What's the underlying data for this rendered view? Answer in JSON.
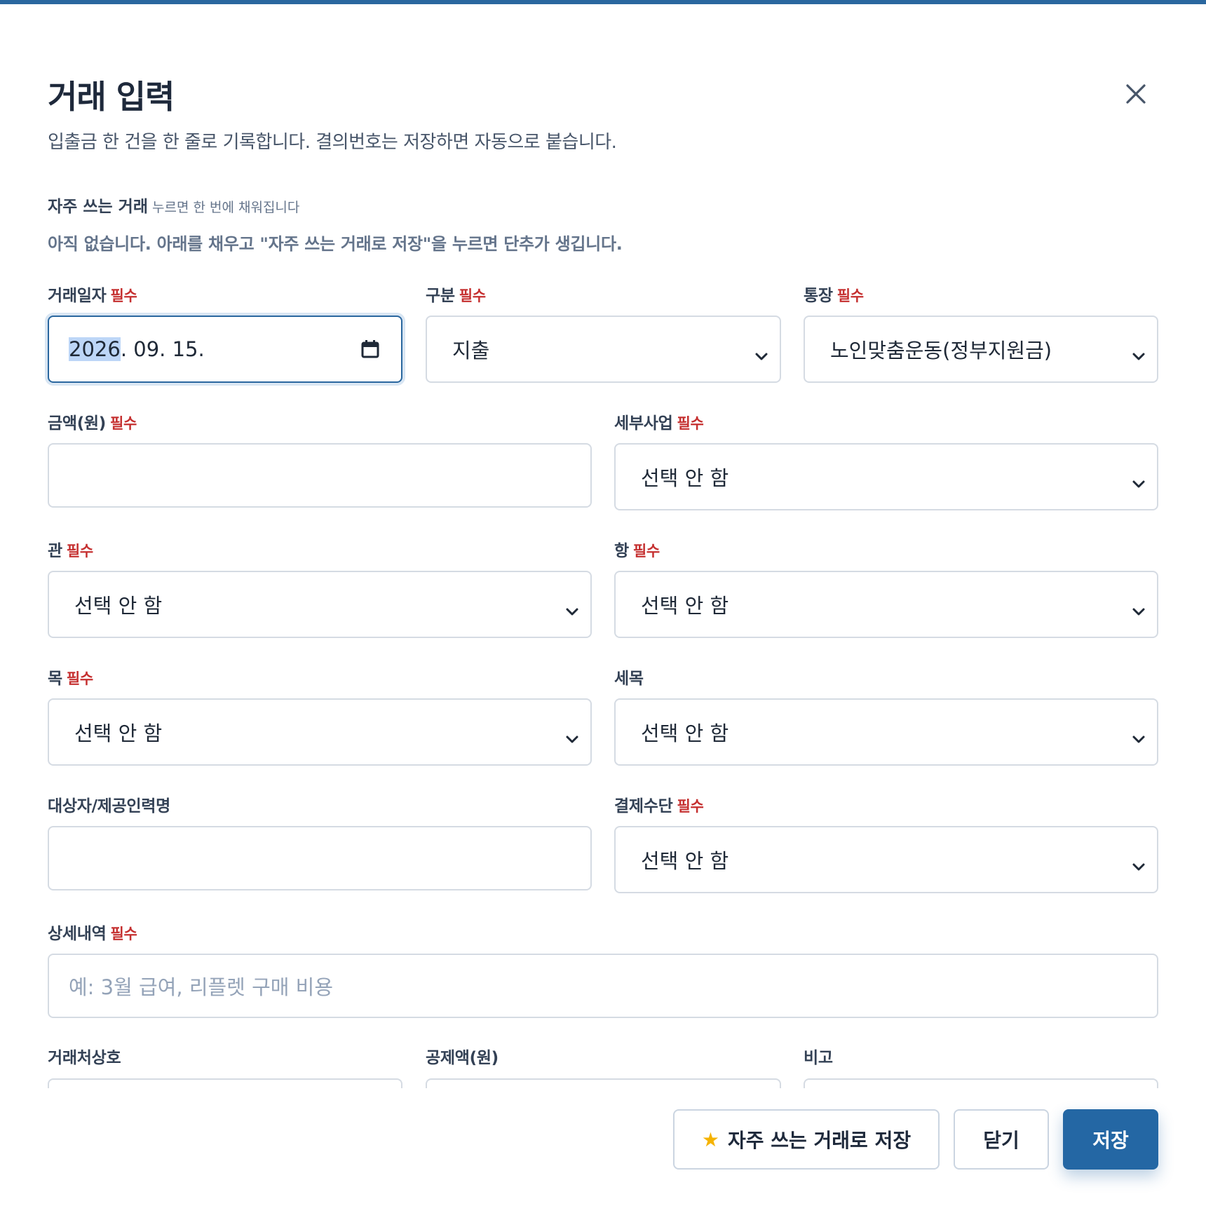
{
  "dialog": {
    "title": "거래 입력",
    "subtitle": "입출금 한 건을 한 줄로 기록합니다. 결의번호는 저장하면 자동으로 붙습니다.",
    "close_icon": "close-icon"
  },
  "favorites": {
    "heading": "자주 쓰는 거래",
    "hint": "누르면 한 번에 채워집니다",
    "empty_text": "아직 없습니다. 아래를 채우고 \"자주 쓰는 거래로 저장\"을 누르면 단추가 생깁니다."
  },
  "required_tag": "필수",
  "fields": {
    "date": {
      "label": "거래일자",
      "year": "2026",
      "rest": ". 09. 15."
    },
    "type": {
      "label": "구분",
      "value": "지출"
    },
    "account": {
      "label": "통장",
      "value": "노인맞춤운동(정부지원금)"
    },
    "amount": {
      "label": "금액(원)",
      "value": ""
    },
    "subproject": {
      "label": "세부사업",
      "value": "선택 안 함"
    },
    "gwan": {
      "label": "관",
      "value": "선택 안 함"
    },
    "hang": {
      "label": "항",
      "value": "선택 안 함"
    },
    "mok": {
      "label": "목",
      "value": "선택 안 함"
    },
    "semok": {
      "label": "세목",
      "value": "선택 안 함"
    },
    "target": {
      "label": "대상자/제공인력명",
      "value": ""
    },
    "payment": {
      "label": "결제수단",
      "value": "선택 안 함"
    },
    "detail": {
      "label": "상세내역",
      "placeholder": "예: 3월 급여, 리플렛 구매 비용"
    },
    "vendor": {
      "label": "거래처상호"
    },
    "deduction": {
      "label": "공제액(원)"
    },
    "note": {
      "label": "비고"
    }
  },
  "buttons": {
    "save_favorite": "자주 쓰는 거래로 저장",
    "close": "닫기",
    "save": "저장"
  },
  "colors": {
    "accent": "#2467a4",
    "required": "#c53030",
    "focus_border": "#2a679f"
  }
}
